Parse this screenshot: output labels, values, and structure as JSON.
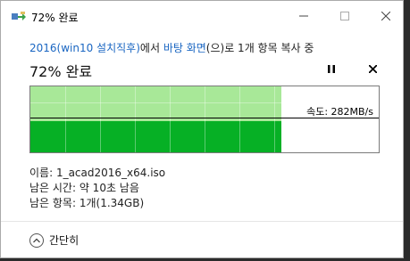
{
  "window": {
    "title": "72% 완료"
  },
  "description": {
    "source": "2016(win10 설치직후)",
    "mid": "에서 ",
    "dest": "바탕 화면",
    "rest": "(으)로 1개 항목 복사 중"
  },
  "progress": {
    "percent_text": "72% 완료",
    "fraction": 0.72,
    "speed_text": "속도: 282MB/s"
  },
  "colors": {
    "graph_light": "#a8e898",
    "graph_dark": "#06b025",
    "link": "#1a66c2"
  },
  "controls": {
    "pause_icon": "pause-icon",
    "stop_icon": "stop-icon"
  },
  "details": {
    "name": "이름: 1_acad2016_x64.iso",
    "time_left": "남은 시간: 약 10초 남음",
    "items_left": "남은 항목: 1개(1.34GB)"
  },
  "footer": {
    "label": "간단히"
  }
}
